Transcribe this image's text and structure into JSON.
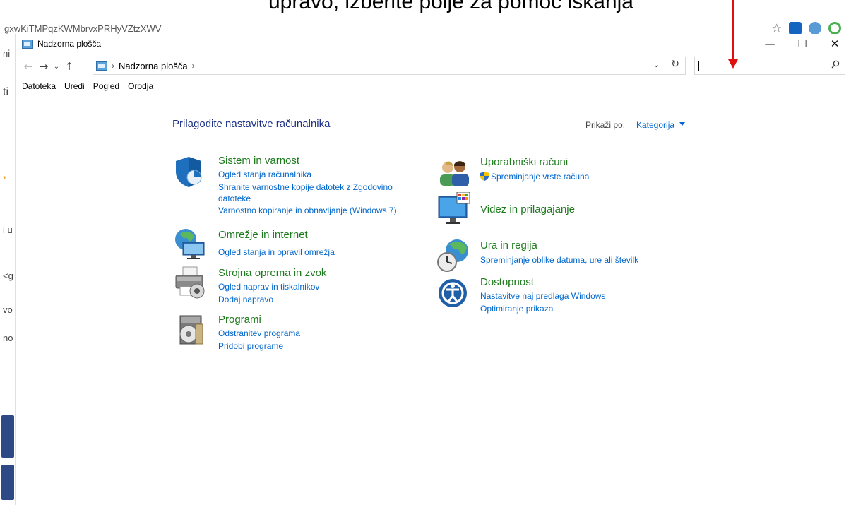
{
  "background": {
    "caption_fragment": "upravo, izberite polje za pomoč iskanja",
    "url_fragment": "gxwKiTMPqzKWMbrvxPRHyVZtzXWV",
    "left_fragments": [
      "ni",
      "ti",
      "i u",
      "<g",
      "vo",
      "no"
    ]
  },
  "window": {
    "title": "Nadzorna plošča",
    "controls": {
      "minimize": "—",
      "maximize": "☐",
      "close": "✕"
    }
  },
  "nav": {
    "back": "←",
    "forward": "→",
    "recent": "⌄",
    "up": "↑"
  },
  "address": {
    "separator": "›",
    "path": "Nadzorna plošča",
    "dropdown": "⌄",
    "refresh": "↻"
  },
  "search": {
    "value": "",
    "placeholder": "",
    "icon": "⌕"
  },
  "menu": [
    "Datoteka",
    "Uredi",
    "Pogled",
    "Orodja"
  ],
  "content": {
    "heading": "Prilagodite nastavitve računalnika",
    "view_by_label": "Prikaži po:",
    "view_by_value": "Kategorija",
    "categories_left": [
      {
        "title": "Sistem in varnost",
        "links": [
          "Ogled stanja računalnika",
          "Shranite varnostne kopije datotek z Zgodovino datoteke",
          "Varnostno kopiranje in obnavljanje (Windows 7)"
        ]
      },
      {
        "title": "Omrežje in internet",
        "links": [
          "Ogled stanja in opravil omrežja"
        ]
      },
      {
        "title": "Strojna oprema in zvok",
        "links": [
          "Ogled naprav in tiskalnikov",
          "Dodaj napravo"
        ]
      },
      {
        "title": "Programi",
        "links": [
          "Odstranitev programa",
          "Pridobi programe"
        ]
      }
    ],
    "categories_right": [
      {
        "title": "Uporabniški računi",
        "links": [
          "Spreminjanje vrste računa"
        ]
      },
      {
        "title": "Videz in prilagajanje",
        "links": []
      },
      {
        "title": "Ura in regija",
        "links": [
          "Spreminjanje oblike datuma, ure ali številk"
        ]
      },
      {
        "title": "Dostopnost",
        "links": [
          "Nastavitve naj predlaga Windows",
          "Optimiranje prikaza"
        ]
      }
    ]
  },
  "colors": {
    "heading_blue": "#1e3287",
    "link_blue": "#0066cc",
    "category_green": "#1d7a1d",
    "annotation_red": "#e01010"
  }
}
